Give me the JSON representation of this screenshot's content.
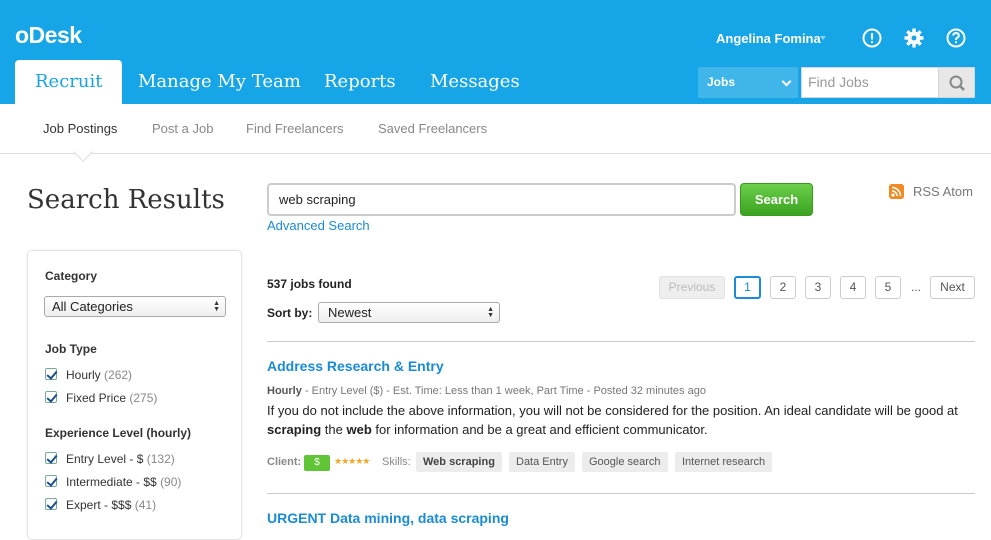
{
  "header": {
    "logo": "oDesk",
    "user_name": "Angelina Fomina",
    "tabs": [
      {
        "label": "Recruit"
      },
      {
        "label": "Manage My Team"
      },
      {
        "label": "Reports"
      },
      {
        "label": "Messages"
      }
    ],
    "search_scope": "Jobs",
    "search_placeholder": "Find Jobs",
    "icons": [
      "alert-icon",
      "gear-icon",
      "help-icon",
      "search-icon"
    ]
  },
  "subnav": {
    "items": [
      {
        "label": "Job Postings"
      },
      {
        "label": "Post a Job"
      },
      {
        "label": "Find Freelancers"
      },
      {
        "label": "Saved Freelancers"
      }
    ]
  },
  "page_title": "Search Results",
  "filters": {
    "category_title": "Category",
    "category_value": "All Categories",
    "job_type_title": "Job Type",
    "job_types": [
      {
        "label": "Hourly",
        "count": "(262)"
      },
      {
        "label": "Fixed Price",
        "count": "(275)"
      }
    ],
    "experience_title": "Experience Level (hourly)",
    "experience": [
      {
        "label": "Entry Level - $",
        "count": "(132)"
      },
      {
        "label": "Intermediate - $$",
        "count": "(90)"
      },
      {
        "label": "Expert - $$$",
        "count": "(41)"
      }
    ]
  },
  "search": {
    "query": "web scraping",
    "button": "Search",
    "advanced": "Advanced Search",
    "rss": "RSS Atom"
  },
  "results": {
    "count": "537 jobs found",
    "sort_label": "Sort by:",
    "sort_value": "Newest",
    "pagination": {
      "previous": "Previous",
      "pages": [
        "1",
        "2",
        "3",
        "4",
        "5"
      ],
      "ellipsis": "...",
      "next": "Next"
    },
    "jobs": [
      {
        "title": "Address Research & Entry",
        "type": "Hourly",
        "meta": " - Entry Level ($) - Est. Time: Less than 1 week, Part Time - Posted 32 minutes ago",
        "desc_1": "If you do not include the above information, you will not be considered for the position. An ideal candidate will be good at",
        "desc_2_bold_1": "scraping",
        "desc_2_mid": " the ",
        "desc_2_bold_2": "web",
        "desc_2_rest": " for information and be a great and efficient communicator.",
        "client_label": "Client:",
        "client_badge": "$",
        "stars": "★★★★★",
        "skills_label": "Skills:",
        "skills": [
          "Web scraping",
          "Data Entry",
          "Google search",
          "Internet research"
        ]
      },
      {
        "title": "URGENT Data mining, data scraping"
      }
    ]
  },
  "colors": {
    "header_bg": "#16a5e6",
    "link": "#1a8bd4",
    "search_button": "#4cb52c",
    "rss": "#f08a24"
  }
}
